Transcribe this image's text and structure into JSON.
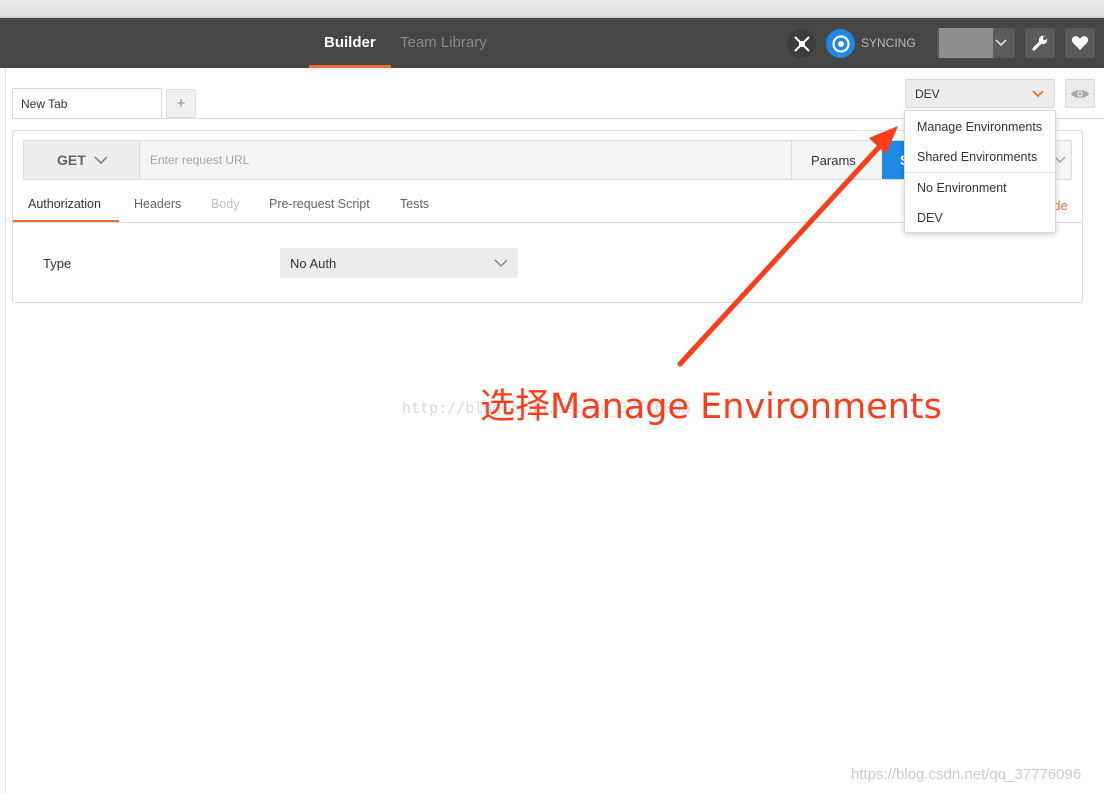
{
  "header": {
    "tabs": [
      {
        "label": "Builder",
        "active": true
      },
      {
        "label": "Team Library",
        "active": false
      }
    ],
    "sync_status": "SYNCING",
    "accent_color": "#f26b3a"
  },
  "request_tabs": {
    "items": [
      {
        "label": "New Tab"
      }
    ],
    "add_label": "+"
  },
  "environment": {
    "selected": "DEV",
    "dropdown": {
      "items": [
        {
          "label": "Manage Environments"
        },
        {
          "label": "Shared Environments"
        },
        {
          "label": "No Environment"
        },
        {
          "label": "DEV"
        }
      ]
    }
  },
  "request": {
    "method": "GET",
    "url_placeholder": "Enter request URL",
    "url_value": "",
    "params_label": "Params",
    "send_label_visible": "S",
    "send_color": "#1e88e5"
  },
  "subtabs": {
    "items": [
      {
        "label": "Authorization",
        "state": "active"
      },
      {
        "label": "Headers",
        "state": "normal"
      },
      {
        "label": "Body",
        "state": "disabled"
      },
      {
        "label": "Pre-request Script",
        "state": "normal"
      },
      {
        "label": "Tests",
        "state": "normal"
      }
    ],
    "code_link_visible": "ode"
  },
  "auth": {
    "type_label": "Type",
    "type_value": "No Auth"
  },
  "annotation": {
    "text": "选择Manage Environments",
    "color": "#ff3c1a"
  },
  "watermarks": {
    "center": "http://blog.csdn.net/qq_37776096",
    "corner": "https://blog.csdn.net/qq_37776096"
  }
}
